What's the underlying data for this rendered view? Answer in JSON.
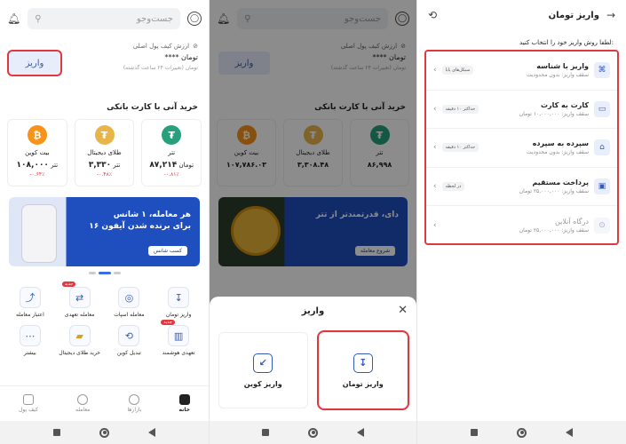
{
  "screen1": {
    "search_placeholder": "جست‌وجو",
    "balance_label": "ارزش کیف پول اصلی",
    "balance_value": "**** تومان",
    "balance_note": "تومان (تغییرات ۲۴ ساعت گذشته)",
    "deposit_label": "واریز",
    "buy_title": "خرید آنی با کارت بانکی",
    "coins": [
      {
        "name": "بیت کوین",
        "price": "۱۰۸,۰۰۰",
        "unit": "تتر",
        "change": "-۰.۶۴٪",
        "symbol": "₿",
        "color": "#f7931a"
      },
      {
        "name": "طلای دیجیتال",
        "price": "۳,۳۳۰",
        "unit": "تتر",
        "change": "-۰.۴۸٪",
        "symbol": "₮",
        "color": "#e8b54a"
      },
      {
        "name": "تتر",
        "price": "۸۷,۲۱۴",
        "unit": "تومان",
        "change": "-۰.۸۱٪",
        "symbol": "₮",
        "color": "#26a17b"
      }
    ],
    "banner": {
      "line1": "هر معامله، ۱ شانس",
      "line2": "برای برنده شدن آیفون ۱۶",
      "button": "کسب شانس"
    },
    "grid": [
      {
        "label": "اعتبار معامله",
        "icon": "credit-icon",
        "glyph": "⤴",
        "tag": ""
      },
      {
        "label": "معامله تعهدی",
        "icon": "margin-icon",
        "glyph": "⇄",
        "tag": "جدید"
      },
      {
        "label": "معامله اسپات",
        "icon": "spot-icon",
        "glyph": "◎",
        "tag": ""
      },
      {
        "label": "واریز تومان",
        "icon": "deposit-toman-icon",
        "glyph": "↧",
        "tag": ""
      },
      {
        "label": "بیشتر",
        "icon": "more-icon",
        "glyph": "⋯",
        "tag": ""
      },
      {
        "label": "خرید طلای دیجیتال",
        "icon": "gold-icon",
        "glyph": "▰",
        "tag": ""
      },
      {
        "label": "تبدیل کوین",
        "icon": "convert-icon",
        "glyph": "⟲",
        "tag": ""
      },
      {
        "label": "تعهدی هوشمند",
        "icon": "smart-margin-icon",
        "glyph": "▥",
        "tag": "جدید"
      }
    ],
    "tabs": [
      {
        "label": "کیف پول",
        "active": false
      },
      {
        "label": "معامله",
        "active": false
      },
      {
        "label": "بازارها",
        "active": false
      },
      {
        "label": "خانه",
        "active": true
      }
    ]
  },
  "screen2": {
    "search_placeholder": "جست‌وجو",
    "coins": [
      {
        "name": "بیت کوین",
        "price": "۱۰۷,۷۸۶.۰۳",
        "symbol": "₿",
        "color": "#f7931a"
      },
      {
        "name": "طلای دیجیتال",
        "price": "۳,۳۰۸.۴۸",
        "symbol": "₮",
        "color": "#e8b54a"
      },
      {
        "name": "تتر",
        "price": "۸۶,۹۹۸",
        "symbol": "₮",
        "color": "#26a17b"
      }
    ],
    "banner": {
      "line1": "دای، قدرتمندتر از تتر",
      "button": "شروع معامله"
    },
    "sheet": {
      "title": "واریز",
      "option_coin": "واریز کوین",
      "option_toman": "واریز تومان"
    }
  },
  "screen3": {
    "title": "واریز تومان",
    "subtitle": "لطفا روش واریز خود را انتخاب کنید:",
    "methods": [
      {
        "title": "واریز با شناسه",
        "sub": "سقف واریز: بدون محدودیت",
        "badge": "سیکل‌های پایا",
        "disabled": false,
        "icon": "id-deposit-icon",
        "glyph": "⌘"
      },
      {
        "title": "کارت به کارت",
        "sub": "سقف واریز: ۱۰,۰۰۰,۰۰۰ تومان",
        "badge": "حداکثر ۱۰ دقیقه",
        "disabled": false,
        "icon": "card-icon",
        "glyph": "▭"
      },
      {
        "title": "سپرده به سپرده",
        "sub": "سقف واریز: بدون محدودیت",
        "badge": "حداکثر ۱۰ دقیقه",
        "disabled": false,
        "icon": "bank-icon",
        "glyph": "⌂"
      },
      {
        "title": "پرداخت مستقیم",
        "sub": "سقف واریز: ۲۵,۰۰۰,۰۰۰ تومان",
        "badge": "در لحظه",
        "disabled": false,
        "icon": "direct-pay-icon",
        "glyph": "▣"
      },
      {
        "title": "درگاه آنلاین",
        "sub": "سقف واریز: ۲۵,۰۰۰,۰۰۰ تومان",
        "badge": "",
        "disabled": true,
        "icon": "gateway-icon",
        "glyph": "⊙"
      }
    ]
  }
}
